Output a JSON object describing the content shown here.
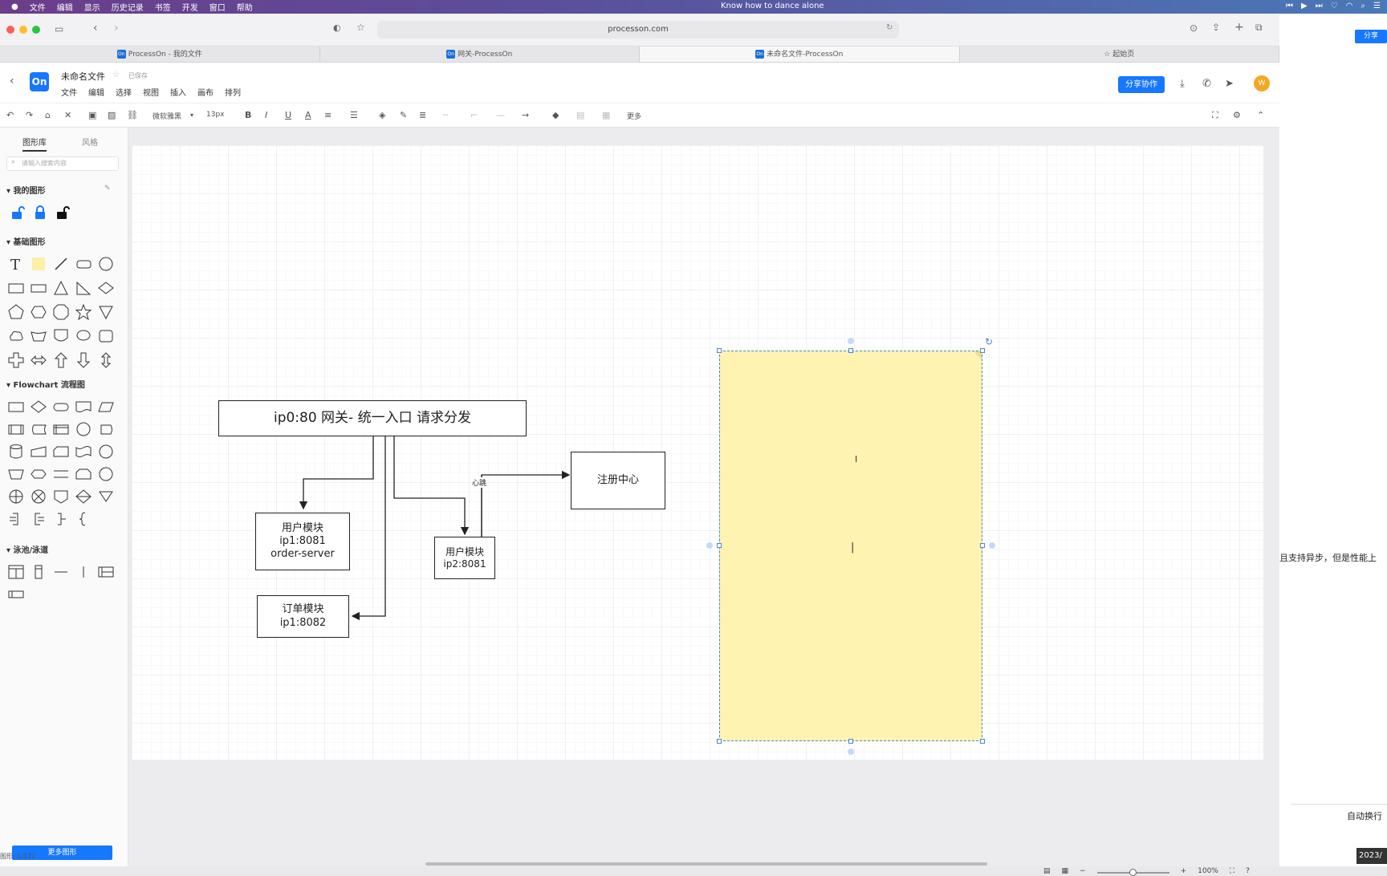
{
  "menubar": {
    "items": [
      "文件",
      "编辑",
      "显示",
      "历史记录",
      "书签",
      "开发",
      "窗口",
      "帮助"
    ],
    "now_playing": "Know how to dance alone"
  },
  "browser": {
    "url": "processon.com",
    "tabs": [
      {
        "label": "ProcessOn - 我的文件"
      },
      {
        "label": "网关-ProcessOn"
      },
      {
        "label": "未命名文件-ProcessOn"
      },
      {
        "label": "起始页"
      }
    ]
  },
  "app": {
    "logo": "On",
    "doc_title": "未命名文件",
    "saved_status": "已保存",
    "menus": [
      "文件",
      "编辑",
      "选择",
      "视图",
      "插入",
      "画布",
      "排列"
    ],
    "share_label": "分享协作",
    "avatar": "W"
  },
  "toolbar": {
    "font_family": "微软雅黑",
    "font_size": "13px",
    "more_label": "更多"
  },
  "left_panel": {
    "tabs": [
      "图形库",
      "风格"
    ],
    "search_placeholder": "请输入搜索内容",
    "sections": {
      "my_shapes": "我的图形",
      "basic": "基础图形",
      "flowchart": "Flowchart 流程图",
      "swimlane": "泳池/泳道"
    },
    "more_shapes": "更多图形",
    "status": "图形: 1/172"
  },
  "diagram": {
    "gateway": "ip0:80 网关- 统一入口 请求分发",
    "user_module_1": "用户模块\nip1:8081\norder-server",
    "order_module": "订单模块\nip1:8082",
    "user_module_2": "用户模块\nip2:8081",
    "registry": "注册中心",
    "heartbeat_label": "心跳",
    "sticky_color": "#fef3b0"
  },
  "bottom": {
    "zoom": "100%"
  },
  "right_strip": {
    "share": "分享",
    "text_fragment": "且支持异步，但是性能上",
    "auto_wrap": "自动换行",
    "date_fragment": "2023/"
  }
}
